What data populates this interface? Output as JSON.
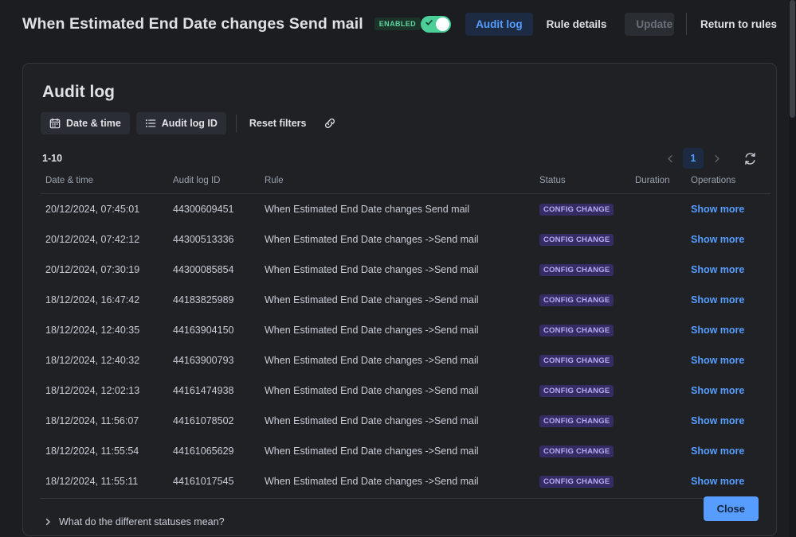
{
  "header": {
    "rule_title": "When Estimated End Date changes Send mail",
    "enabled_badge": "ENABLED",
    "toggle_state_on": true,
    "tab_audit_log": "Audit log",
    "tab_rule_details": "Rule details",
    "update_label": "Update",
    "return_label": "Return to rules",
    "accent_blue": "#579dff",
    "enabled_green": "#4bce97"
  },
  "panel": {
    "title": "Audit log",
    "filters": {
      "date_time": "Date & time",
      "audit_log_id": "Audit log ID",
      "reset_filters": "Reset filters"
    },
    "count_label": "1-10",
    "pagination": {
      "current_page": "1"
    },
    "table": {
      "columns": [
        "Date & time",
        "Audit log ID",
        "Rule",
        "Status",
        "Duration",
        "Operations"
      ],
      "rows": [
        {
          "datetime": "20/12/2024, 07:45:01",
          "id": "44300609451",
          "rule": "When Estimated End Date changes Send mail",
          "status": "CONFIG CHANGE",
          "duration": "",
          "operation": "Show more"
        },
        {
          "datetime": "20/12/2024, 07:42:12",
          "id": "44300513336",
          "rule": "When Estimated End Date changes ->Send mail",
          "status": "CONFIG CHANGE",
          "duration": "",
          "operation": "Show more"
        },
        {
          "datetime": "20/12/2024, 07:30:19",
          "id": "44300085854",
          "rule": "When Estimated End Date changes ->Send mail",
          "status": "CONFIG CHANGE",
          "duration": "",
          "operation": "Show more"
        },
        {
          "datetime": "18/12/2024, 16:47:42",
          "id": "44183825989",
          "rule": "When Estimated End Date changes ->Send mail",
          "status": "CONFIG CHANGE",
          "duration": "",
          "operation": "Show more"
        },
        {
          "datetime": "18/12/2024, 12:40:35",
          "id": "44163904150",
          "rule": "When Estimated End Date changes ->Send mail",
          "status": "CONFIG CHANGE",
          "duration": "",
          "operation": "Show more"
        },
        {
          "datetime": "18/12/2024, 12:40:32",
          "id": "44163900793",
          "rule": "When Estimated End Date changes ->Send mail",
          "status": "CONFIG CHANGE",
          "duration": "",
          "operation": "Show more"
        },
        {
          "datetime": "18/12/2024, 12:02:13",
          "id": "44161474938",
          "rule": "When Estimated End Date changes ->Send mail",
          "status": "CONFIG CHANGE",
          "duration": "",
          "operation": "Show more"
        },
        {
          "datetime": "18/12/2024, 11:56:07",
          "id": "44161078502",
          "rule": "When Estimated End Date changes ->Send mail",
          "status": "CONFIG CHANGE",
          "duration": "",
          "operation": "Show more"
        },
        {
          "datetime": "18/12/2024, 11:55:54",
          "id": "44161065629",
          "rule": "When Estimated End Date changes ->Send mail",
          "status": "CONFIG CHANGE",
          "duration": "",
          "operation": "Show more"
        },
        {
          "datetime": "18/12/2024, 11:55:11",
          "id": "44161017545",
          "rule": "When Estimated End Date changes ->Send mail",
          "status": "CONFIG CHANGE",
          "duration": "",
          "operation": "Show more"
        }
      ]
    },
    "accordion_label": "What do the different statuses mean?",
    "close_label": "Close"
  },
  "icons": {
    "calendar": "calendar-icon",
    "list": "list-icon",
    "link": "link-icon",
    "refresh": "refresh-icon",
    "chevron_left": "chevron-left-icon",
    "chevron_right": "chevron-right-icon",
    "chevron_down": "chevron-down-icon"
  }
}
